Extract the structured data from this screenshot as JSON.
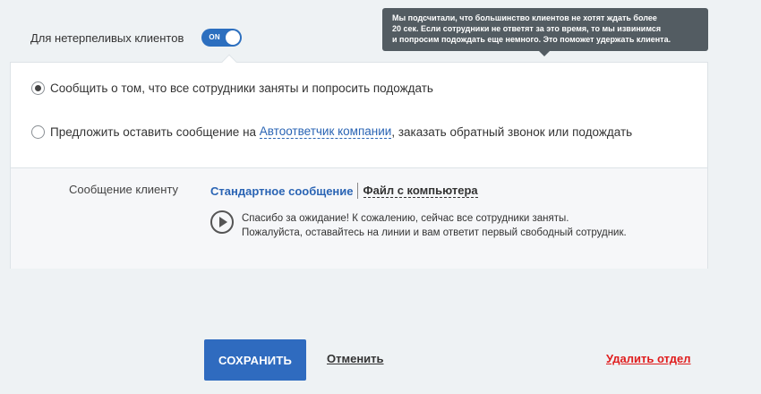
{
  "impatient": {
    "label": "Для нетерпеливых клиентов",
    "toggle_state": "ON"
  },
  "tooltip": {
    "line1": "Мы подсчитали, что большинство клиентов не хотят ждать более",
    "line2": "20 сек. Если сотрудники не ответят за это время, то мы извинимся",
    "line3": "и попросим подождать еще немного. Это поможет удержать клиента."
  },
  "options": [
    {
      "label": "Сообщить о том, что все сотрудники заняты и попросить подождать",
      "checked": true
    },
    {
      "label_before": "Предложить оставить сообщение на ",
      "link": "Автоответчик компании",
      "label_after": ", заказать обратный звонок или подождать",
      "checked": false
    }
  ],
  "message": {
    "label": "Сообщение клиенту",
    "tab_standard": "Стандартное сообщение",
    "tab_file": "Файл с компьютера",
    "line1": "Спасибо за ожидание! К сожалению, сейчас все сотрудники заняты.",
    "line2": "Пожалуйста, оставайтесь на линии и вам ответит первый свободный сотрудник."
  },
  "actions": {
    "save": "СОХРАНИТЬ",
    "cancel": "Отменить",
    "delete": "Удалить отдел"
  },
  "colors": {
    "accent": "#2f6bbf",
    "danger": "#e01d1d",
    "tooltip_bg": "#535c62"
  }
}
